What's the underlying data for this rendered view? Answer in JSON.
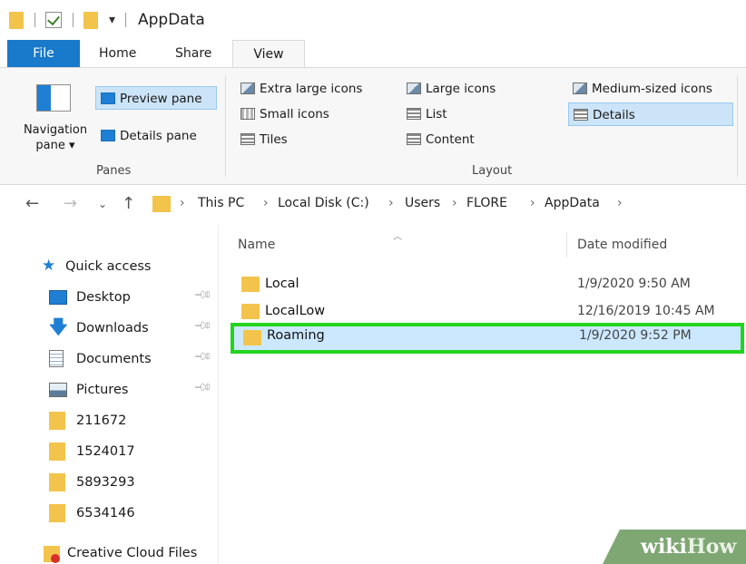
{
  "window": {
    "title": "AppData"
  },
  "tabs": {
    "file": "File",
    "home": "Home",
    "share": "Share",
    "view": "View"
  },
  "ribbon": {
    "navigation_pane": "Navigation pane",
    "navigation_pane_l1": "Navigation",
    "navigation_pane_l2": "pane",
    "preview_pane": "Preview pane",
    "details_pane": "Details pane",
    "panes_group": "Panes",
    "layout": {
      "extra_large_icons": "Extra large icons",
      "large_icons": "Large icons",
      "medium_icons": "Medium-sized icons",
      "small_icons": "Small icons",
      "list": "List",
      "details": "Details",
      "tiles": "Tiles",
      "content": "Content"
    },
    "layout_group": "Layout"
  },
  "address": {
    "crumbs": [
      "This PC",
      "Local Disk (C:)",
      "Users",
      "FLORE",
      "AppData"
    ]
  },
  "nav": {
    "quick_access": "Quick access",
    "items": [
      {
        "label": "Desktop",
        "pinned": true
      },
      {
        "label": "Downloads",
        "pinned": true
      },
      {
        "label": "Documents",
        "pinned": true
      },
      {
        "label": "Pictures",
        "pinned": true
      },
      {
        "label": "211672"
      },
      {
        "label": "1524017"
      },
      {
        "label": "5893293"
      },
      {
        "label": "6534146"
      }
    ],
    "creative_cloud": "Creative Cloud Files"
  },
  "files": {
    "col_name": "Name",
    "col_date": "Date modified",
    "rows": [
      {
        "name": "Local",
        "date": "1/9/2020 9:50 AM"
      },
      {
        "name": "LocalLow",
        "date": "12/16/2019 10:45 AM"
      },
      {
        "name": "Roaming",
        "date": "1/9/2020 9:52 PM",
        "selected": true
      }
    ]
  },
  "watermark": {
    "wiki": "wiki",
    "how": "How"
  },
  "colors": {
    "file_tab": "#1979ca",
    "folder": "#f3c44b",
    "highlight_border": "#22d51f",
    "selection": "#cce8ff"
  }
}
